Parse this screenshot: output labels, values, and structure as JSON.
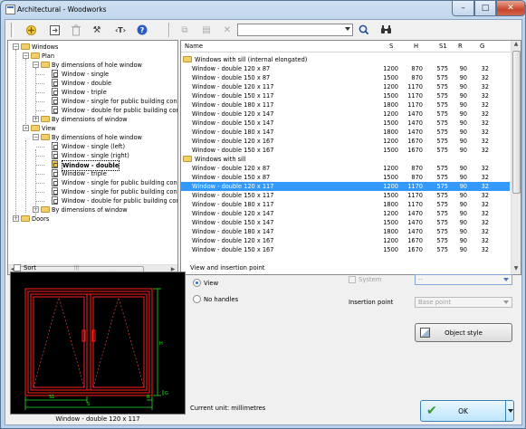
{
  "window": {
    "title": "Architectural - Woodworks"
  },
  "toolbar": {
    "search_value": ""
  },
  "tree": {
    "items": [
      {
        "label": "Windows",
        "level": 0,
        "type": "folder",
        "exp": "-"
      },
      {
        "label": "Plan",
        "level": 1,
        "type": "folder",
        "exp": "-"
      },
      {
        "label": "By dimensions of hole window",
        "level": 2,
        "type": "folder",
        "exp": "-"
      },
      {
        "label": "Window - single",
        "level": 3,
        "type": "doc"
      },
      {
        "label": "Window - double",
        "level": 3,
        "type": "doc"
      },
      {
        "label": "Window - triple",
        "level": 3,
        "type": "doc"
      },
      {
        "label": "Window - single for public building constr",
        "level": 3,
        "type": "doc"
      },
      {
        "label": "Window - double for public building constr",
        "level": 3,
        "type": "doc"
      },
      {
        "label": "By dimensions of window",
        "level": 2,
        "type": "folder",
        "exp": "+"
      },
      {
        "label": "View",
        "level": 1,
        "type": "folder",
        "exp": "-"
      },
      {
        "label": "By dimensions of hole window",
        "level": 2,
        "type": "folder",
        "exp": "-"
      },
      {
        "label": "Window - single (left)",
        "level": 3,
        "type": "doc"
      },
      {
        "label": "Window - single (right)",
        "level": 3,
        "type": "doc"
      },
      {
        "label": "Window - double",
        "level": 3,
        "type": "doc",
        "sel": true
      },
      {
        "label": "Window - triple",
        "level": 3,
        "type": "doc"
      },
      {
        "label": "Window - single for public building constr",
        "level": 3,
        "type": "doc"
      },
      {
        "label": "Window - single for public building constr",
        "level": 3,
        "type": "doc"
      },
      {
        "label": "Window - double for public building constr",
        "level": 3,
        "type": "doc"
      },
      {
        "label": "By dimensions of window",
        "level": 2,
        "type": "folder",
        "exp": "+"
      },
      {
        "label": "Doors",
        "level": 0,
        "type": "folder",
        "exp": "+"
      }
    ]
  },
  "list": {
    "columns": [
      "Name",
      "S",
      "H",
      "S1",
      "R",
      "G"
    ],
    "groups": [
      {
        "label": "Windows with sill (internal elongated)",
        "rows": [
          [
            "Window - double 120 x 87",
            "1200",
            "870",
            "575",
            "90",
            "32"
          ],
          [
            "Window - double 150 x 87",
            "1500",
            "870",
            "575",
            "90",
            "32"
          ],
          [
            "Window - double 120 x 117",
            "1200",
            "1170",
            "575",
            "90",
            "32"
          ],
          [
            "Window - double 150 x 117",
            "1500",
            "1170",
            "575",
            "90",
            "32"
          ],
          [
            "Window - double 180 x 117",
            "1800",
            "1170",
            "575",
            "90",
            "32"
          ],
          [
            "Window - double 120 x 147",
            "1200",
            "1470",
            "575",
            "90",
            "32"
          ],
          [
            "Window - double 150 x 147",
            "1500",
            "1470",
            "575",
            "90",
            "32"
          ],
          [
            "Window - double 180 x 147",
            "1800",
            "1470",
            "575",
            "90",
            "32"
          ],
          [
            "Window - double 120 x 167",
            "1200",
            "1670",
            "575",
            "90",
            "32"
          ],
          [
            "Window - double 150 x 167",
            "1500",
            "1670",
            "575",
            "90",
            "32"
          ]
        ]
      },
      {
        "label": "Windows with sill",
        "rows": [
          [
            "Window - double 120 x 87",
            "1200",
            "870",
            "575",
            "90",
            "32"
          ],
          [
            "Window - double 150 x 87",
            "1500",
            "870",
            "575",
            "90",
            "32"
          ],
          [
            "Window - double 120 x 117",
            "1200",
            "1170",
            "575",
            "90",
            "32"
          ],
          [
            "Window - double 150 x 117",
            "1500",
            "1170",
            "575",
            "90",
            "32"
          ],
          [
            "Window - double 180 x 117",
            "1800",
            "1170",
            "575",
            "90",
            "32"
          ],
          [
            "Window - double 120 x 147",
            "1200",
            "1470",
            "575",
            "90",
            "32"
          ],
          [
            "Window - double 150 x 147",
            "1500",
            "1470",
            "575",
            "90",
            "32"
          ],
          [
            "Window - double 180 x 147",
            "1800",
            "1470",
            "575",
            "90",
            "32"
          ],
          [
            "Window - double 120 x 167",
            "1200",
            "1670",
            "575",
            "90",
            "32"
          ],
          [
            "Window - double 150 x 167",
            "1500",
            "1670",
            "575",
            "90",
            "32"
          ]
        ]
      }
    ],
    "selected": {
      "group": 1,
      "row": 2
    }
  },
  "sort_label": "Sort",
  "preview": {
    "caption": "Window - double 120 x 117",
    "labels": {
      "s1": "S1",
      "s": "S",
      "r": "R",
      "g": "G",
      "h": "H"
    }
  },
  "view_section": {
    "title": "View and insertion point",
    "view_label": "View",
    "nohandles_label": "No handles"
  },
  "system": {
    "label": "System",
    "value": "--"
  },
  "insertion": {
    "label": "Insertion point",
    "value": "Base point"
  },
  "object_style_label": "Object style",
  "current_unit": "Current unit: millimetres",
  "ok_label": "OK",
  "colors": {
    "selection": "#3399ff",
    "folder": "#f3cf6b",
    "ok_check": "#2f9a2f"
  }
}
